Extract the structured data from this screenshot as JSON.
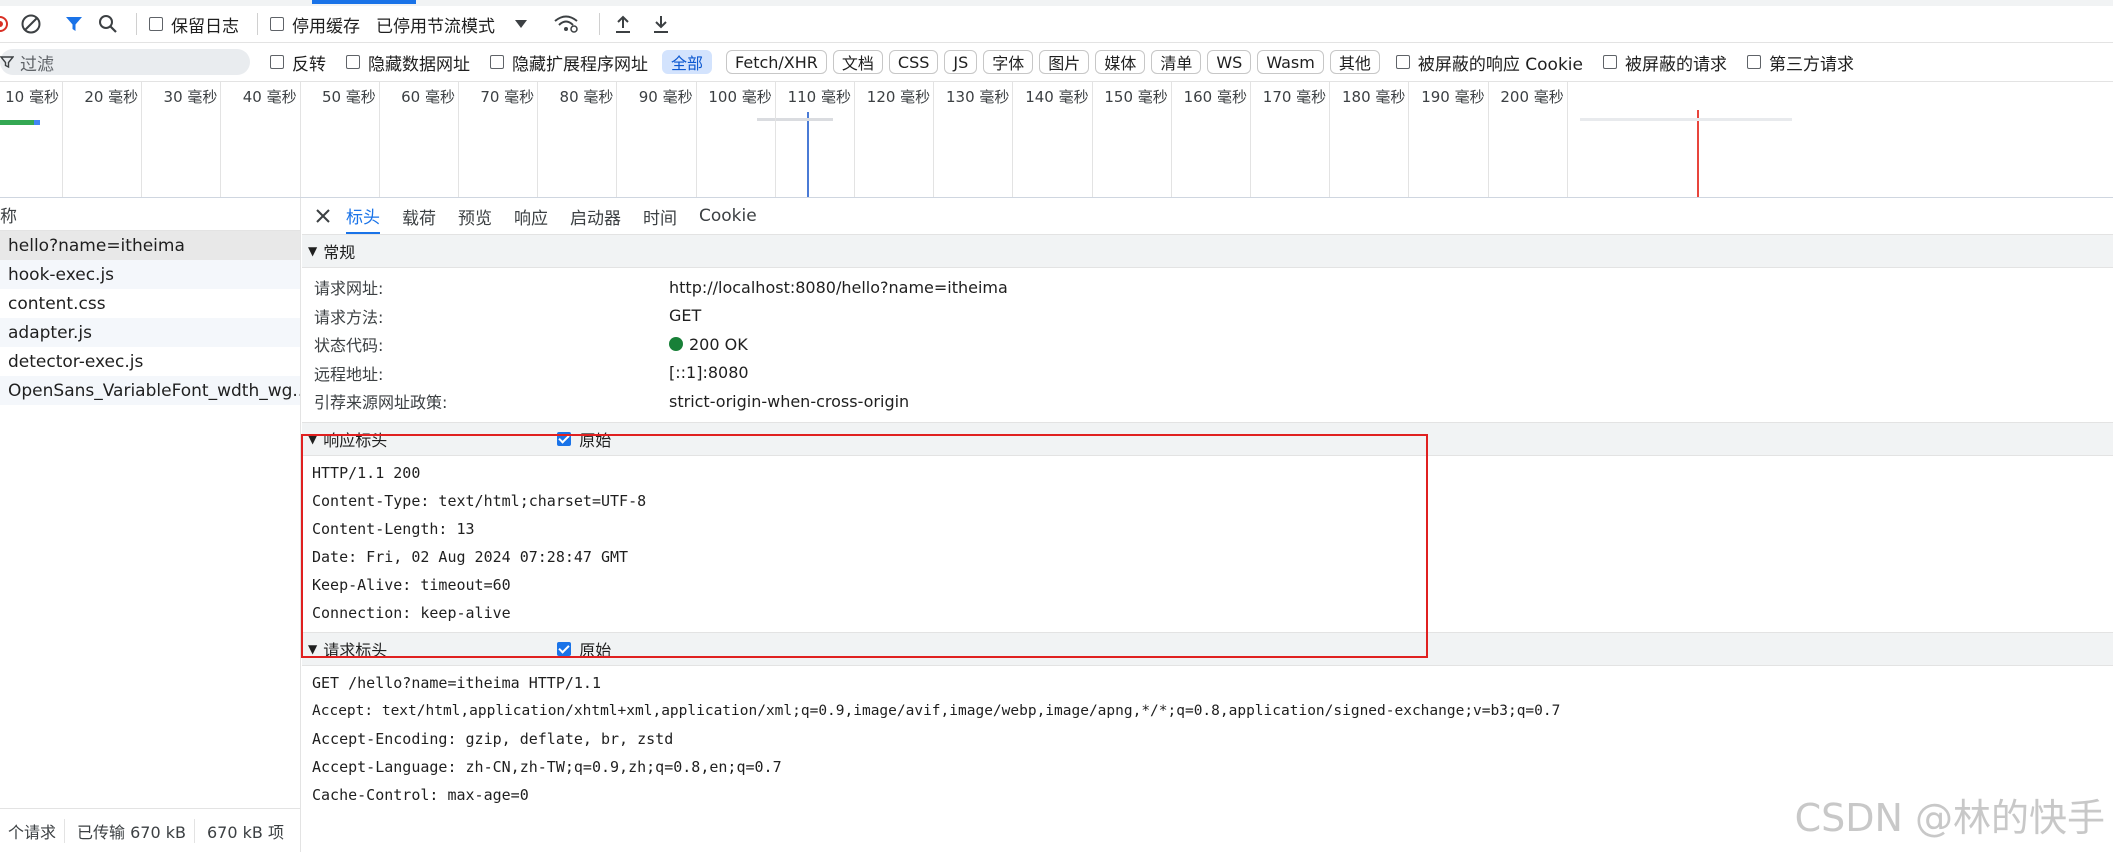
{
  "toolbar": {
    "preserve_log": "保留日志",
    "disable_cache": "停用缓存",
    "throttle": "已停用节流模式"
  },
  "filterbar": {
    "placeholder": "过滤",
    "invert": "反转",
    "hide_data_urls": "隐藏数据网址",
    "hide_ext_urls": "隐藏扩展程序网址",
    "types": [
      "全部",
      "Fetch/XHR",
      "文档",
      "CSS",
      "JS",
      "字体",
      "图片",
      "媒体",
      "清单",
      "WS",
      "Wasm",
      "其他"
    ],
    "blocked_cookies": "被屏蔽的响应 Cookie",
    "blocked_requests": "被屏蔽的请求",
    "third_party": "第三方请求"
  },
  "timeline": {
    "ticks": [
      "10 毫秒",
      "20 毫秒",
      "30 毫秒",
      "40 毫秒",
      "50 毫秒",
      "60 毫秒",
      "70 毫秒",
      "80 毫秒",
      "90 毫秒",
      "100 毫秒",
      "110 毫秒",
      "120 毫秒",
      "130 毫秒",
      "140 毫秒",
      "150 毫秒",
      "160 毫秒",
      "170 毫秒",
      "180 毫秒",
      "190 毫秒",
      "200 毫秒"
    ]
  },
  "requests": {
    "header": "称",
    "items": [
      "hello?name=itheima",
      "hook-exec.js",
      "content.css",
      "adapter.js",
      "detector-exec.js",
      "OpenSans_VariableFont_wdth_wg..."
    ]
  },
  "statusbar": {
    "count": "个请求",
    "transferred": "已传输 670 kB",
    "resources": "670 kB 项"
  },
  "detail_tabs": [
    "标头",
    "载荷",
    "预览",
    "响应",
    "启动器",
    "时间",
    "Cookie"
  ],
  "general": {
    "title": "常规",
    "rows": [
      {
        "k": "请求网址:",
        "v": "http://localhost:8080/hello?name=itheima"
      },
      {
        "k": "请求方法:",
        "v": "GET"
      },
      {
        "k": "状态代码:",
        "v": "200 OK"
      },
      {
        "k": "远程地址:",
        "v": "[::1]:8080"
      },
      {
        "k": "引荐来源网址政策:",
        "v": "strict-origin-when-cross-origin"
      }
    ]
  },
  "response_headers": {
    "title": "响应标头",
    "raw_label": "原始",
    "lines": [
      "HTTP/1.1 200",
      "Content-Type: text/html;charset=UTF-8",
      "Content-Length: 13",
      "Date: Fri, 02 Aug 2024 07:28:47 GMT",
      "Keep-Alive: timeout=60",
      "Connection: keep-alive"
    ]
  },
  "request_headers": {
    "title": "请求标头",
    "raw_label": "原始",
    "lines": [
      "GET /hello?name=itheima HTTP/1.1",
      "Accept: text/html,application/xhtml+xml,application/xml;q=0.9,image/avif,image/webp,image/apng,*/*;q=0.8,application/signed-exchange;v=b3;q=0.7",
      "Accept-Encoding: gzip, deflate, br, zstd",
      "Accept-Language: zh-CN,zh-TW;q=0.9,zh;q=0.8,en;q=0.7",
      "Cache-Control: max-age=0"
    ]
  },
  "watermark": "CSDN @林的快手",
  "colors": {
    "accent": "#1a73e8",
    "highlight_box": "#e02020",
    "status_ok": "#188038"
  }
}
